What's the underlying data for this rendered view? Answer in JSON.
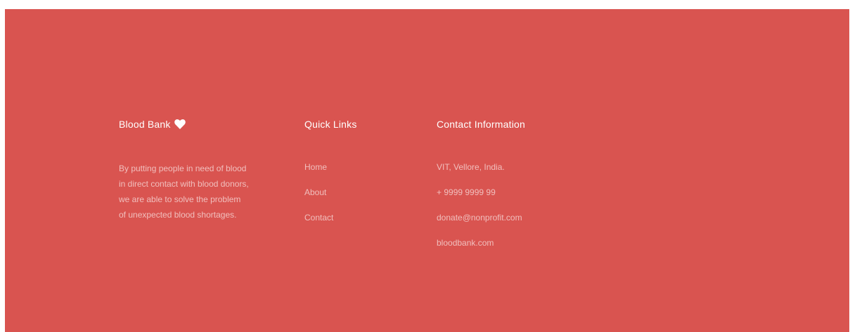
{
  "footer": {
    "brand": {
      "title": "Blood Bank",
      "icon": "heart-icon",
      "description": "By putting people in need of blood in direct contact with blood donors, we are able to solve the problem of unexpected blood shortages."
    },
    "quick_links": {
      "title": "Quick Links",
      "items": [
        "Home",
        "About",
        "Contact"
      ]
    },
    "contact": {
      "title": "Contact Information",
      "items": [
        "VIT, Vellore, India.",
        "+ 9999 9999 99",
        "donate@nonprofit.com",
        "bloodbank.com"
      ]
    },
    "colors": {
      "background": "#d95450",
      "heading": "#ffffff",
      "text": "#f2b6b3"
    }
  }
}
